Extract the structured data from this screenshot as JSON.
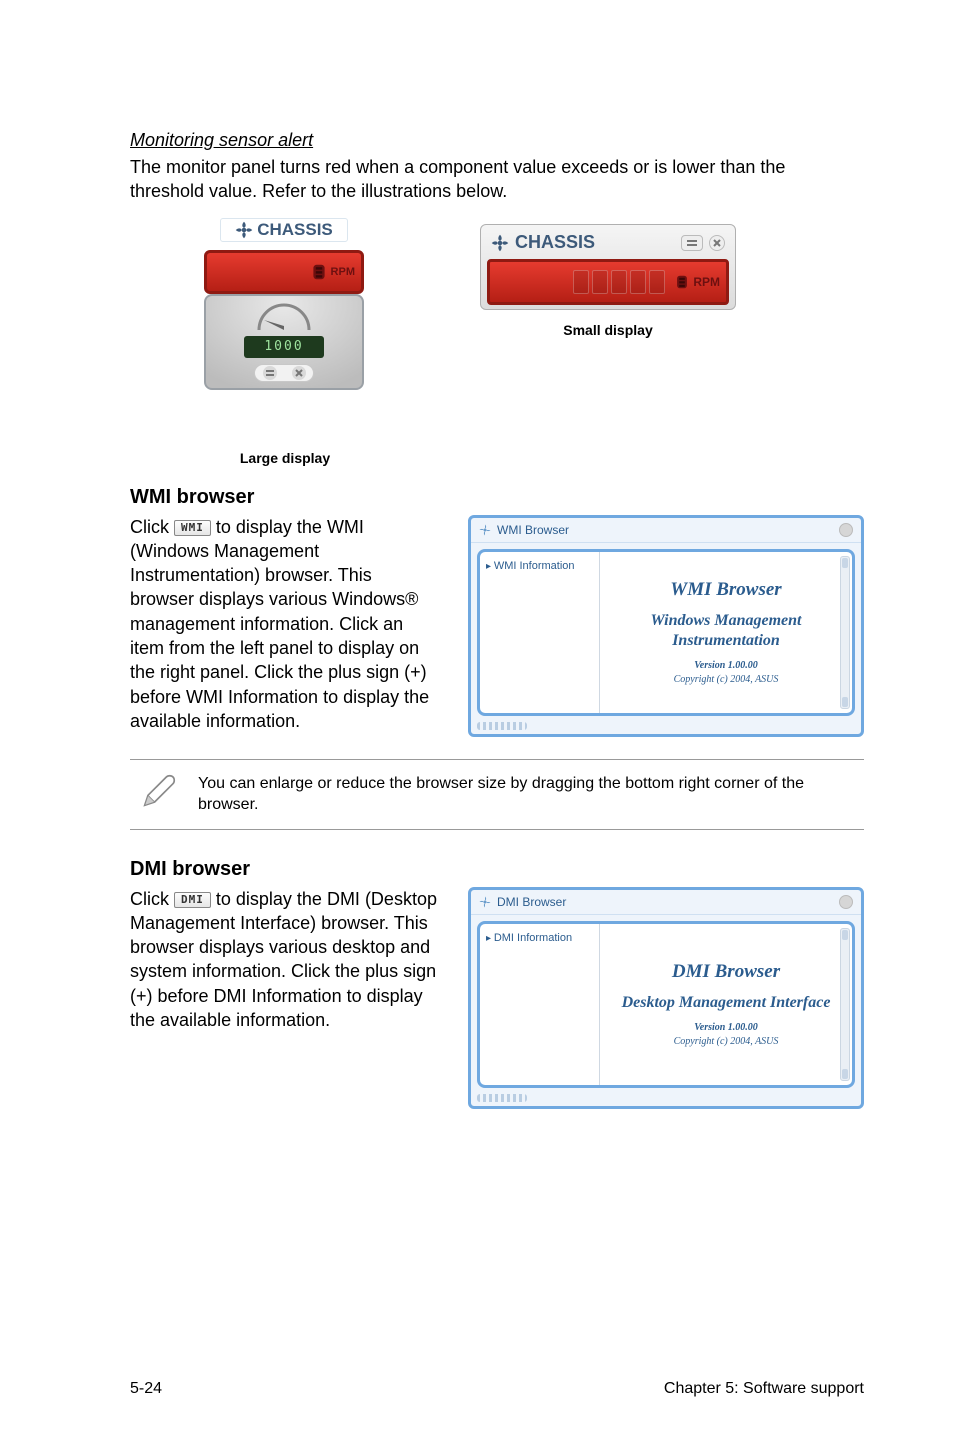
{
  "monitoring": {
    "heading": "Monitoring sensor alert",
    "body": "The monitor panel turns red when a component value exceeds or is lower than the threshold value. Refer to the illustrations below.",
    "large_caption": "Large display",
    "small_caption": "Small display",
    "chassis_label": "CHASSIS",
    "rpm_label": "RPM",
    "lcd_text": "1000"
  },
  "wmi": {
    "heading": "WMI browser",
    "btn": "WMI",
    "body_pre": "Click ",
    "body_post": " to display the WMI (Windows Management Instrumentation) browser. This browser displays various Windows® management information. Click an item from the left panel to display on the right panel. Click the plus sign (+) before WMI Information to display the available information.",
    "panel_title": "WMI Browser",
    "tree_root": "WMI Information",
    "main_title": "WMI Browser",
    "sub_title": "Windows Management Instrumentation",
    "version": "Version 1.00.00",
    "copyright": "Copyright (c) 2004, ASUS"
  },
  "note": {
    "text": "You can enlarge or reduce the browser size by dragging the bottom right corner of the browser."
  },
  "dmi": {
    "heading": "DMI browser",
    "btn": "DMI",
    "body_pre": "Click ",
    "body_post": " to display the DMI (Desktop Management Interface) browser. This browser displays various desktop and system information. Click the plus sign (+) before DMI Information to display the available information.",
    "panel_title": "DMI Browser",
    "tree_root": "DMI Information",
    "main_title": "DMI Browser",
    "sub_title": "Desktop Management Interface",
    "version": "Version 1.00.00",
    "copyright": "Copyright (c) 2004, ASUS"
  },
  "footer": {
    "left": "5-24",
    "right": "Chapter 5: Software support"
  }
}
